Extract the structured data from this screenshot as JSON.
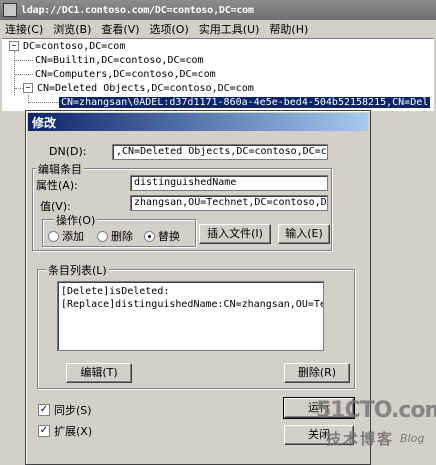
{
  "window": {
    "title": "ldap://DC1.contoso.com/DC=contoso,DC=com"
  },
  "menu": [
    "连接(C)",
    "浏览(B)",
    "查看(V)",
    "选项(O)",
    "实用工具(U)",
    "帮助(H)"
  ],
  "tree": {
    "root": "DC=contoso,DC=com",
    "children": [
      "CN=Builtin,DC=contoso,DC=com",
      "CN=Computers,DC=contoso,DC=com",
      "CN=Deleted Objects,DC=contoso,DC=com"
    ],
    "selected": "CN=zhangsan\\0ADEL:d37d1171-860a-4e5e-bed4-504b52158215,CN=Del"
  },
  "dialog": {
    "title": "修改",
    "dn_label": "DN(D):",
    "dn_value": ",CN=Deleted Objects,DC=contoso,DC=com",
    "edit_group_title": "编辑条目",
    "attr_label": "属性(A):",
    "attr_value": "distinguishedName",
    "value_label": "值(V):",
    "value_value": "zhangsan,OU=Technet,DC=contoso,DC=com",
    "op_group_title": "操作(O)",
    "op_add": "添加",
    "op_delete": "删除",
    "op_replace": "替换",
    "op_selected": "替换",
    "insert_file_button": "插入文件(I)",
    "enter_button": "输入(E)",
    "list_group_title": "条目列表(L)",
    "list_items": [
      "[Delete]isDeleted:",
      "[Replace]distinguishedName:CN=zhangsan,OU=Te"
    ],
    "edit_button": "编辑(T)",
    "remove_button": "删除(R)",
    "sync_label": "同步(S)",
    "sync_checked": true,
    "extended_label": "扩展(X)",
    "extended_checked": true,
    "run_button": "运行",
    "close_button": "关闭"
  },
  "watermark": {
    "main": "51CTO.com",
    "sub": "技术博客",
    "blog": "Blog"
  }
}
